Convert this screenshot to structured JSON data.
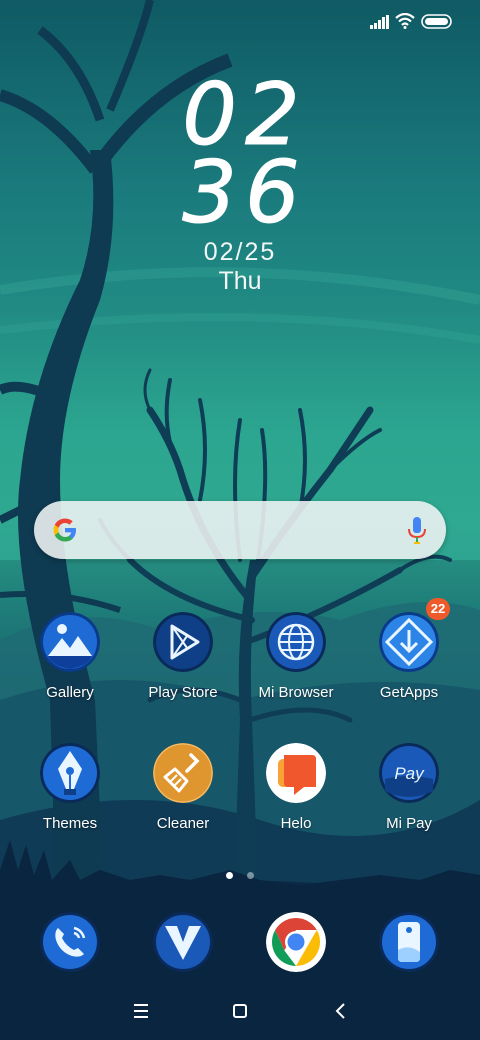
{
  "status_bar": {
    "icons": [
      "signal-icon",
      "wifi-icon",
      "battery-icon"
    ]
  },
  "clock": {
    "hours": "02",
    "minutes": "36",
    "date": "02/25",
    "day": "Thu"
  },
  "search_bar": {
    "icons": [
      "google-g-icon",
      "microphone-icon"
    ]
  },
  "home_apps": [
    {
      "label": "Gallery",
      "icon": "gallery-icon",
      "badge": ""
    },
    {
      "label": "Play Store",
      "icon": "play-store-icon",
      "badge": ""
    },
    {
      "label": "Mi Browser",
      "icon": "globe-icon",
      "badge": ""
    },
    {
      "label": "GetApps",
      "icon": "download-icon",
      "badge": "22"
    },
    {
      "label": "Themes",
      "icon": "pen-nib-icon",
      "badge": ""
    },
    {
      "label": "Cleaner",
      "icon": "broom-icon",
      "badge": ""
    },
    {
      "label": "Helo",
      "icon": "chat-bubble-icon",
      "badge": ""
    },
    {
      "label": "Mi Pay",
      "icon": "mi-pay-icon",
      "badge": "",
      "icon_text": "Pay"
    }
  ],
  "page_indicator": {
    "pages": 2,
    "active": 1
  },
  "dock": [
    {
      "icon": "phone-icon"
    },
    {
      "icon": "messages-icon"
    },
    {
      "icon": "chrome-icon"
    },
    {
      "icon": "camera-icon"
    }
  ],
  "nav_bar": {
    "buttons": [
      "menu-icon",
      "home-icon",
      "back-icon"
    ]
  },
  "colors": {
    "badge": "#ef5a2a",
    "clock_text": "#ffffff",
    "search_bg": "#f0f4f4",
    "icon_blue": "#1e6bd6",
    "cleaner_orange": "#e0962e",
    "helo_red": "#f0572c"
  }
}
